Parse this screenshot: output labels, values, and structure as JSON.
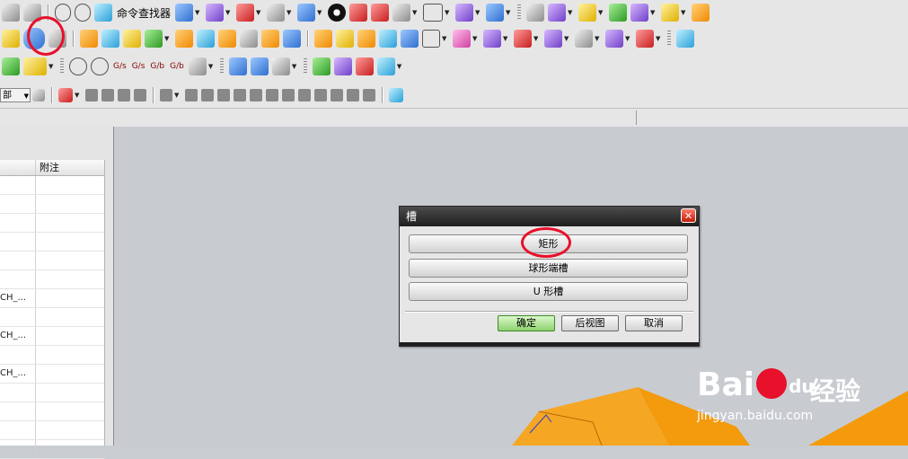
{
  "toolbar": {
    "command_finder_label": "命令查找器",
    "section_dropdown_value": "部"
  },
  "sketch_labels": [
    "G/s",
    "G/s",
    "G/b",
    "G/b"
  ],
  "navigator": {
    "columns": [
      "",
      "附注"
    ],
    "rows": [
      "",
      "",
      "",
      "",
      "",
      "",
      "CH_...",
      "",
      "CH_...",
      "",
      "CH_...",
      "",
      "",
      "",
      ""
    ]
  },
  "dialog": {
    "title": "槽",
    "close_glyph": "✕",
    "options": [
      "矩形",
      "球形端槽",
      "U 形槽"
    ],
    "actions": {
      "ok": "确定",
      "back": "后视图",
      "cancel": "取消"
    }
  },
  "watermark": {
    "logo": "Bai",
    "logo_tail": "du",
    "brand_cn": "经验",
    "url": "jingyan.baidu.com"
  },
  "colors": {
    "highlight_ring": "#e8102a",
    "model_face": "#f59a0c",
    "viewport": "#c8ccd1"
  }
}
